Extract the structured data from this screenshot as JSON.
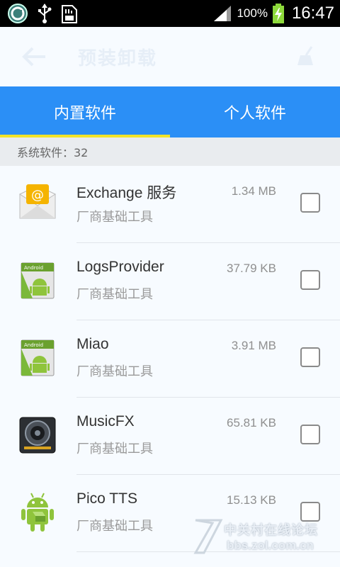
{
  "status_bar": {
    "battery_percent": "100%",
    "time": "16:47",
    "icons": [
      "app-notification-icon",
      "usb-icon",
      "sd-card-icon",
      "signal-icon",
      "battery-charging-icon"
    ]
  },
  "action_bar": {
    "title": "预装卸载",
    "back_icon": "back-arrow-icon",
    "right_icon": "broom-icon"
  },
  "tabs": [
    {
      "label": "内置软件",
      "active": true
    },
    {
      "label": "个人软件",
      "active": false
    }
  ],
  "section_header": "系统软件：32",
  "apps": [
    {
      "name": "Exchange 服务",
      "subtitle": "厂商基础工具",
      "size": "1.34 MB",
      "icon": "email-envelope-icon",
      "checked": false
    },
    {
      "name": "LogsProvider",
      "subtitle": "厂商基础工具",
      "size": "37.79 KB",
      "icon": "android-app-icon",
      "checked": false
    },
    {
      "name": "Miao",
      "subtitle": "厂商基础工具",
      "size": "3.91 MB",
      "icon": "android-app-icon",
      "checked": false
    },
    {
      "name": "MusicFX",
      "subtitle": "厂商基础工具",
      "size": "65.81 KB",
      "icon": "speaker-icon",
      "checked": false
    },
    {
      "name": "Pico TTS",
      "subtitle": "厂商基础工具",
      "size": "15.13 KB",
      "icon": "android-robot-icon",
      "checked": false
    }
  ],
  "watermark": {
    "text_cn": "中关村在线论坛",
    "text_en": "bbs.zol.com.cn"
  },
  "colors": {
    "tab_bar": "#2b8ff6",
    "tab_indicator": "#f2e32a",
    "section_bg": "#e9ecef"
  }
}
